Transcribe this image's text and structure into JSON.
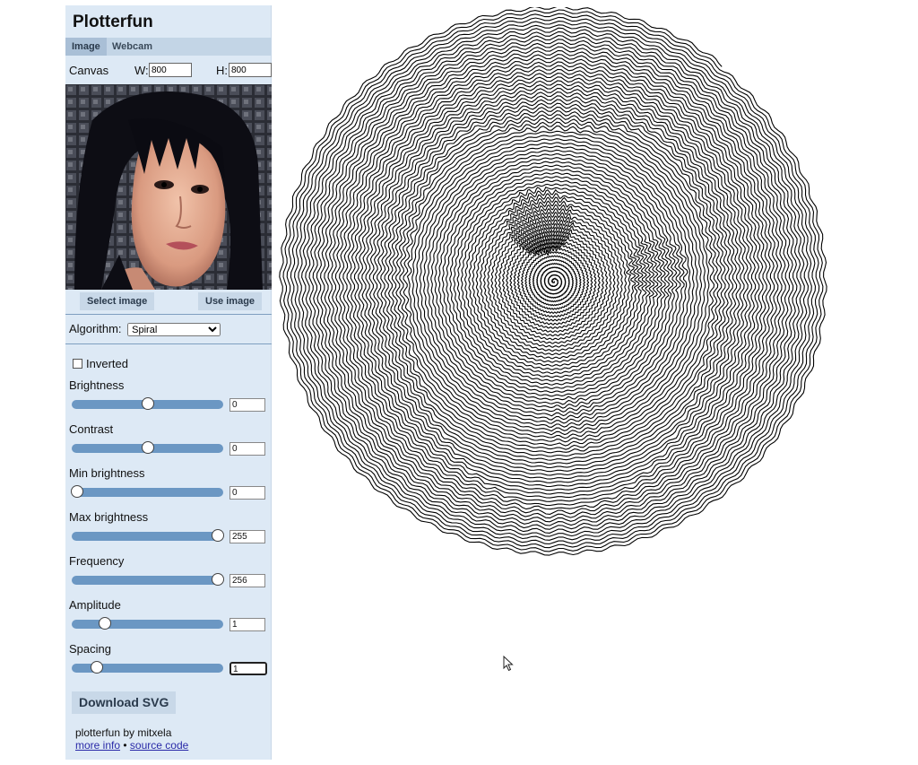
{
  "app": {
    "title": "Plotterfun"
  },
  "tabs": [
    {
      "label": "Image",
      "active": true
    },
    {
      "label": "Webcam",
      "active": false
    }
  ],
  "canvas": {
    "label": "Canvas",
    "w_label": "W:",
    "h_label": "H:",
    "w_value": "800",
    "h_value": "800"
  },
  "image_buttons": {
    "select": "Select image",
    "use": "Use image"
  },
  "algorithm": {
    "label": "Algorithm:",
    "selected": "Spiral"
  },
  "options": {
    "inverted_label": "Inverted",
    "inverted_checked": false
  },
  "sliders": [
    {
      "label": "Brightness",
      "value": "0",
      "fraction": 0.5
    },
    {
      "label": "Contrast",
      "value": "0",
      "fraction": 0.5
    },
    {
      "label": "Min brightness",
      "value": "0",
      "fraction": 0.0
    },
    {
      "label": "Max brightness",
      "value": "255",
      "fraction": 1.0
    },
    {
      "label": "Frequency",
      "value": "256",
      "fraction": 1.0
    },
    {
      "label": "Amplitude",
      "value": "1",
      "fraction": 0.2
    },
    {
      "label": "Spacing",
      "value": "1",
      "fraction": 0.14
    }
  ],
  "download": {
    "label": "Download SVG"
  },
  "credit": {
    "text": "plotterfun by mitxela",
    "more_info": "more info",
    "sep": "•",
    "source_code": "source code"
  },
  "colors": {
    "panel_bg": "#dde9f5",
    "track": "#6b97c3",
    "accent_button": "#c8d8e8"
  }
}
